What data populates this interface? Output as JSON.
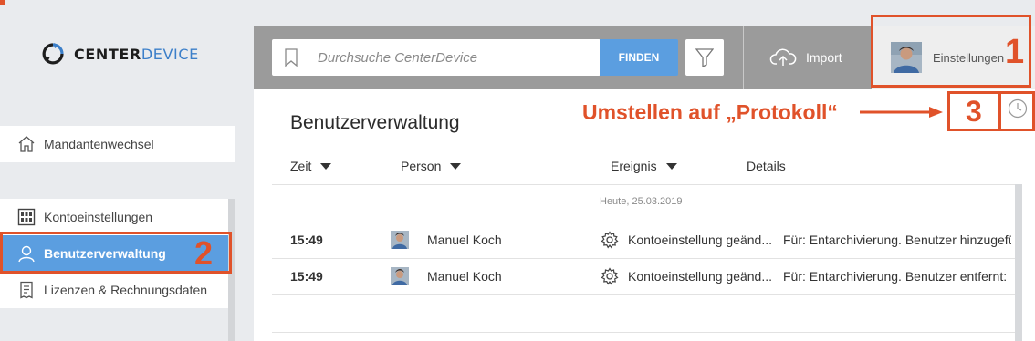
{
  "logo": {
    "text_dark": "CENTER",
    "text_blue": "DEVICE"
  },
  "sidebar": {
    "items": [
      {
        "label": "Mandantenwechsel",
        "icon": "home-icon"
      },
      {
        "label": "Kontoeinstellungen",
        "icon": "grid-icon"
      },
      {
        "label": "Benutzerverwaltung",
        "icon": "user-icon",
        "active": true
      },
      {
        "label": "Lizenzen & Rechnungsdaten",
        "icon": "receipt-icon"
      }
    ]
  },
  "search": {
    "placeholder": "Durchsuche CenterDevice",
    "button": "FINDEN",
    "filter_icon": "filter-icon",
    "bookmark_icon": "bookmark-icon"
  },
  "toolbar": {
    "import_label": "Import",
    "import_icon": "cloud-upload-icon",
    "settings_label": "Einstellungen"
  },
  "main": {
    "title": "Benutzerverwaltung",
    "columns": [
      "Zeit",
      "Person",
      "Ereignis",
      "Details"
    ],
    "date_separator": "Heute, 25.03.2019",
    "rows": [
      {
        "time": "15:49",
        "person": "Manuel Koch",
        "event": "Kontoeinstellung geänd...",
        "details": "Für: Entarchivierung. Benutzer hinzugefü"
      },
      {
        "time": "15:49",
        "person": "Manuel Koch",
        "event": "Kontoeinstellung geänd...",
        "details": "Für: Entarchivierung. Benutzer entfernt: I"
      }
    ],
    "history_icon": "clock-icon"
  },
  "annotations": {
    "n1": "1",
    "n2": "2",
    "n3": "3",
    "text": "Umstellen auf „Protokoll“"
  },
  "colors": {
    "accent": "#5b9ee0",
    "annotation": "#e0522a",
    "topbar": "#9b9b9b"
  }
}
